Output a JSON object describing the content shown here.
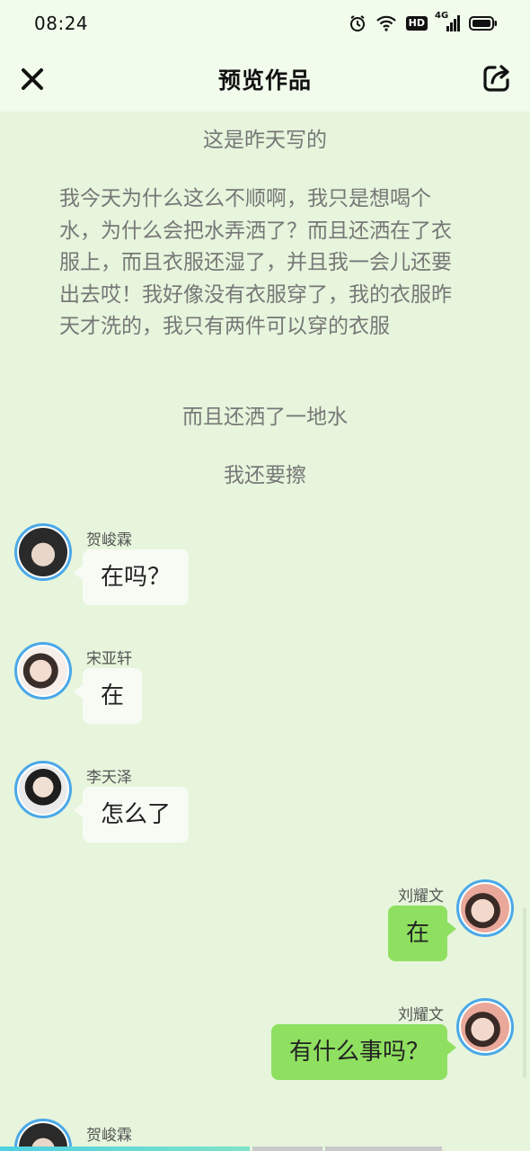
{
  "status_bar": {
    "time": "08:24",
    "icons": [
      "alarm-icon",
      "wifi-icon",
      "hd-badge",
      "4g-signal-icon",
      "battery-icon"
    ],
    "hd_label": "HD",
    "network_label": "4G"
  },
  "header": {
    "title": "预览作品",
    "close_icon": "close-icon",
    "share_icon": "share-icon"
  },
  "narration": {
    "line1": "这是昨天写的",
    "paragraph": "我今天为什么这么不顺啊，我只是想喝个水，为什么会把水弄洒了？而且还洒在了衣服上，而且衣服还湿了，并且我一会儿还要出去哎！我好像没有衣服穿了，我的衣服昨天才洗的，我只有两件可以穿的衣服",
    "line3": "而且还洒了一地水",
    "line4": "我还要擦"
  },
  "messages": [
    {
      "name": "贺峻霖",
      "text": "在吗？",
      "side": "left"
    },
    {
      "name": "宋亚轩",
      "text": "在",
      "side": "left"
    },
    {
      "name": "李天泽",
      "text": "怎么了",
      "side": "left"
    },
    {
      "name": "刘耀文",
      "text": "在",
      "side": "right"
    },
    {
      "name": "刘耀文",
      "text": "有什么事吗？",
      "side": "right"
    },
    {
      "name": "贺峻霖",
      "text": "",
      "side": "left"
    }
  ],
  "colors": {
    "background": "#e6f5dc",
    "header_bg": "#f1fcec",
    "left_bubble": "#f7fbf4",
    "right_bubble": "#8fe060",
    "avatar_ring": "#4aa8e8",
    "progress_active": "#4dd0e1"
  },
  "progress": {
    "active_fraction": 0.47
  }
}
